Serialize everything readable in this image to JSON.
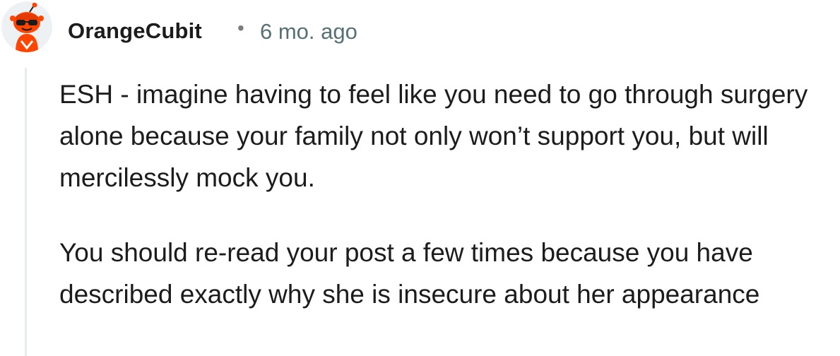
{
  "comment": {
    "author": "OrangeCubit",
    "separator": "•",
    "timestamp": "6 mo. ago",
    "avatar_icon": "snoo-avatar-icon",
    "paragraphs": [
      "ESH - imagine having to feel like you need to go through surgery alone because your family not only won’t support you, but will mercilessly mock you.",
      "You should re-read your post a few times because you have described exactly why she is insecure about her appearance"
    ]
  },
  "colors": {
    "author": "#1c1c1c",
    "timestamp": "#576f76",
    "thread_line": "#e5ebee",
    "avatar_orange": "#ff4500",
    "avatar_bg": "#eef1f3"
  }
}
